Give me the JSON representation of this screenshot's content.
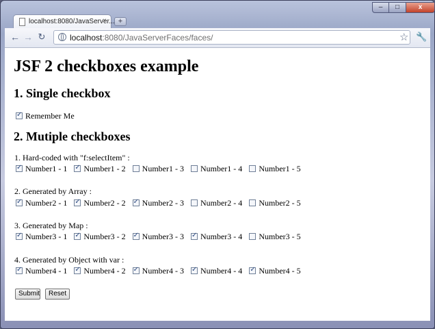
{
  "browser": {
    "tab_title": "localhost:8080/JavaServer...",
    "tab_close": "×",
    "new_tab": "+",
    "window_controls": {
      "minimize": "–",
      "maximize": "□",
      "close": "x"
    },
    "url_host": "localhost",
    "url_path": ":8080/JavaServerFaces/faces/"
  },
  "page": {
    "title": "JSF 2 checkboxes example",
    "section1_heading": "1. Single checkbox",
    "single_checkbox": {
      "label": "Remember Me",
      "checked": true
    },
    "section2_heading": "2. Mutiple checkboxes",
    "groups": [
      {
        "heading": "1. Hard-coded with \"f:selectItem\" :",
        "options": [
          {
            "label": "Number1 - 1",
            "checked": true
          },
          {
            "label": "Number1 - 2",
            "checked": true
          },
          {
            "label": "Number1 - 3",
            "checked": false
          },
          {
            "label": "Number1 - 4",
            "checked": false
          },
          {
            "label": "Number1 - 5",
            "checked": false
          }
        ]
      },
      {
        "heading": "2. Generated by Array :",
        "options": [
          {
            "label": "Number2 - 1",
            "checked": true
          },
          {
            "label": "Number2 - 2",
            "checked": true
          },
          {
            "label": "Number2 - 3",
            "checked": true
          },
          {
            "label": "Number2 - 4",
            "checked": false
          },
          {
            "label": "Number2 - 5",
            "checked": false
          }
        ]
      },
      {
        "heading": "3. Generated by Map :",
        "options": [
          {
            "label": "Number3 - 1",
            "checked": true
          },
          {
            "label": "Number3 - 2",
            "checked": true
          },
          {
            "label": "Number3 - 3",
            "checked": true
          },
          {
            "label": "Number3 - 4",
            "checked": true
          },
          {
            "label": "Number3 - 5",
            "checked": false
          }
        ]
      },
      {
        "heading": "4. Generated by Object with var :",
        "options": [
          {
            "label": "Number4 - 1",
            "checked": true
          },
          {
            "label": "Number4 - 2",
            "checked": true
          },
          {
            "label": "Number4 - 3",
            "checked": true
          },
          {
            "label": "Number4 - 4",
            "checked": true
          },
          {
            "label": "Number4 - 5",
            "checked": true
          }
        ]
      }
    ],
    "submit_label": "Submit",
    "reset_label": "Reset"
  }
}
